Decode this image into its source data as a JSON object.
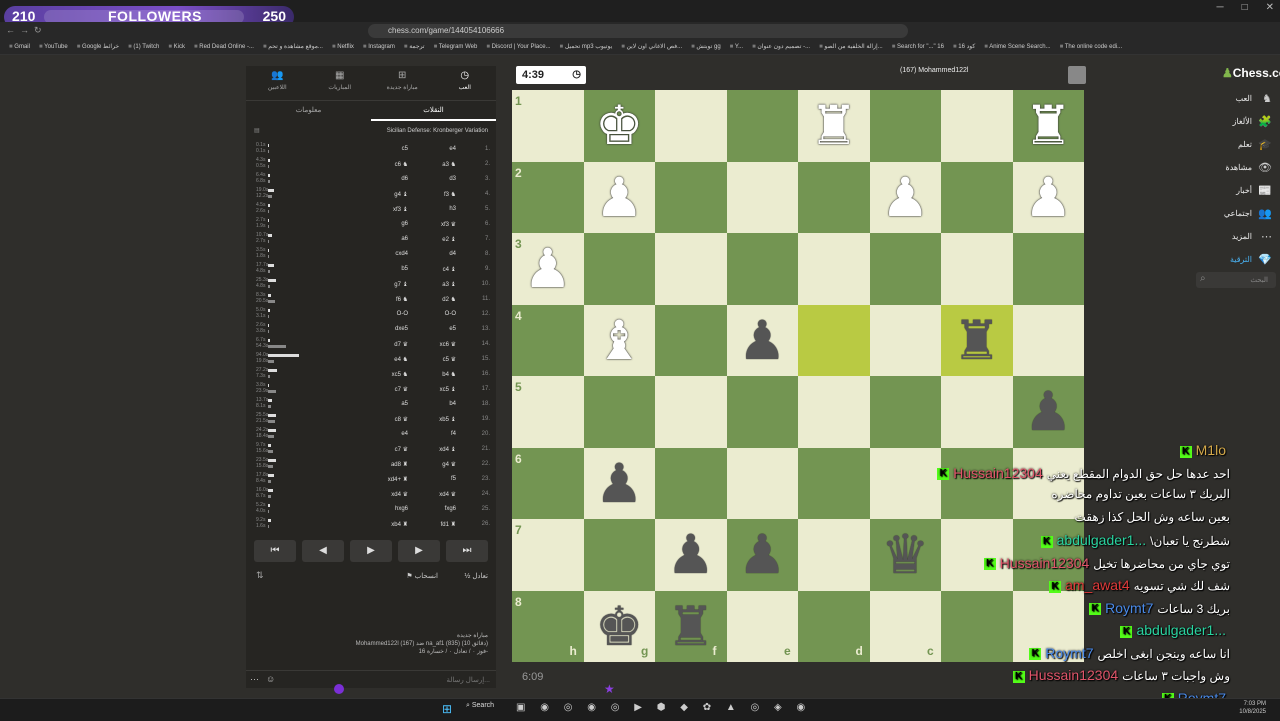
{
  "overlay": {
    "followers_current": "210",
    "followers_label": "FOLLOWERS",
    "followers_goal": "250",
    "progress": 0.84
  },
  "browser": {
    "url": "chess.com/game/144054106666",
    "bookmarks": [
      "Gmail",
      "YouTube",
      "Google خرائط",
      "(1) Twitch",
      "Kick",
      "Red Dead Online -...",
      "موقع مشاهدة و تحم...",
      "Netflix",
      "Instagram",
      "ترجمة",
      "Telegram Web",
      "Discord | Your Place...",
      "تحميل mp3 يوتيوب",
      "فص الاغاني اون لاين...",
      "توبتش gg",
      "Y...",
      "تصميم دون عنوان -...",
      "إزالة الخلفية من الصو...",
      "Search for \"...\" 16",
      "كود 16",
      "Anime Scene Search...",
      "The online code edi..."
    ]
  },
  "panel": {
    "tabs": [
      {
        "label": "العب",
        "icon": "clock-icon"
      },
      {
        "label": "مباراة جديدة",
        "icon": "plus-icon"
      },
      {
        "label": "المباريات",
        "icon": "grid-icon"
      },
      {
        "label": "اللاعبين",
        "icon": "players-icon"
      }
    ],
    "subtabs": [
      "النقلات",
      "معلومات"
    ],
    "opening": "Sicilian Defense: Kronberger Variation",
    "moves": [
      {
        "n": "1.",
        "w": "e4",
        "b": "c5",
        "tw": "0.1s",
        "tb": "0.1s",
        "bw": 0.02,
        "bb": 0.02
      },
      {
        "n": "2.",
        "w": "a3 ♞",
        "b": "c6 ♞",
        "tw": "4.3s",
        "tb": "0.5s",
        "bw": 0.05,
        "bb": 0.02
      },
      {
        "n": "3.",
        "w": "d3",
        "b": "d6",
        "tw": "6.4s",
        "tb": "6.8s",
        "bw": 0.06,
        "bb": 0.06
      },
      {
        "n": "4.",
        "w": "f3 ♞",
        "b": "g4 ♝",
        "tw": "19.0s",
        "tb": "12.2s",
        "bw": 0.16,
        "bb": 0.1
      },
      {
        "n": "5.",
        "w": "h3",
        "b": "xf3 ♝",
        "tw": "4.5s",
        "tb": "2.6s",
        "bw": 0.04,
        "bb": 0.02
      },
      {
        "n": "6.",
        "w": "xf3 ♛",
        "b": "g6",
        "tw": "2.7s",
        "tb": "1.9s",
        "bw": 0.02,
        "bb": 0.02
      },
      {
        "n": "7.",
        "w": "e2 ♝",
        "b": "a6",
        "tw": "10.7s",
        "tb": "2.7s",
        "bw": 0.09,
        "bb": 0.02
      },
      {
        "n": "8.",
        "w": "d4",
        "b": "cxd4",
        "tw": "3.5s",
        "tb": "1.8s",
        "bw": 0.03,
        "bb": 0.02
      },
      {
        "n": "9.",
        "w": "c4 ♝",
        "b": "b5",
        "tw": "17.7s",
        "tb": "4.8s",
        "bw": 0.15,
        "bb": 0.04
      },
      {
        "n": "10.",
        "w": "a3 ♝",
        "b": "g7 ♝",
        "tw": "25.3s",
        "tb": "4.8s",
        "bw": 0.21,
        "bb": 0.04
      },
      {
        "n": "11.",
        "w": "d2 ♞",
        "b": "f6 ♞",
        "tw": "8.3s",
        "tb": "20.5s",
        "bw": 0.07,
        "bb": 0.17
      },
      {
        "n": "12.",
        "w": "O-O",
        "b": "O-O",
        "tw": "5.0s",
        "tb": "3.1s",
        "bw": 0.04,
        "bb": 0.03
      },
      {
        "n": "13.",
        "w": "e5",
        "b": "dxe5",
        "tw": "2.6s",
        "tb": "3.8s",
        "bw": 0.02,
        "bb": 0.03
      },
      {
        "n": "14.",
        "w": "xc6 ♛",
        "b": "d7 ♛",
        "tw": "6.7s",
        "tb": "54.3s",
        "bw": 0.06,
        "bb": 0.45
      },
      {
        "n": "15.",
        "w": "c5 ♛",
        "b": "e4 ♞",
        "tw": "94.0s",
        "tb": "19.8s",
        "bw": 0.78,
        "bb": 0.16
      },
      {
        "n": "16.",
        "w": "b4 ♞",
        "b": "xc5 ♞",
        "tw": "27.2s",
        "tb": "7.3s",
        "bw": 0.23,
        "bb": 0.06
      },
      {
        "n": "17.",
        "w": "xc5 ♝",
        "b": "c7 ♛",
        "tw": "3.8s",
        "tb": "23.9s",
        "bw": 0.03,
        "bb": 0.2
      },
      {
        "n": "18.",
        "w": "b4",
        "b": "a5",
        "tw": "13.7s",
        "tb": "8.1s",
        "bw": 0.11,
        "bb": 0.07
      },
      {
        "n": "19.",
        "w": "xb5 ♝",
        "b": "c8 ♛",
        "tw": "25.5s",
        "tb": "21.5s",
        "bw": 0.21,
        "bb": 0.18
      },
      {
        "n": "20.",
        "w": "f4",
        "b": "e4",
        "tw": "24.2s",
        "tb": "18.4s",
        "bw": 0.2,
        "bb": 0.15
      },
      {
        "n": "21.",
        "w": "xd4 ♝",
        "b": "c7 ♛",
        "tw": "9.7s",
        "tb": "15.6s",
        "bw": 0.08,
        "bb": 0.13
      },
      {
        "n": "22.",
        "w": "g4 ♛",
        "b": "ad8 ♜",
        "tw": "23.5s",
        "tb": "15.8s",
        "bw": 0.2,
        "bb": 0.13
      },
      {
        "n": "23.",
        "w": "f5",
        "b": "xd4+ ♜",
        "tw": "17.8s",
        "tb": "8.4s",
        "bw": 0.15,
        "bb": 0.07
      },
      {
        "n": "24.",
        "w": "xd4 ♛",
        "b": "xd4 ♛",
        "tw": "16.0s",
        "tb": "8.7s",
        "bw": 0.13,
        "bb": 0.07
      },
      {
        "n": "25.",
        "w": "fxg6",
        "b": "hxg6",
        "tw": "5.2s",
        "tb": "4.0s",
        "bw": 0.04,
        "bb": 0.03
      },
      {
        "n": "26.",
        "w": "fd1 ♜",
        "b": "xb4 ♜",
        "tw": "9.2s",
        "tb": "1.6s",
        "bw": 0.08,
        "bb": 0.02
      }
    ],
    "controls": [
      "⏮",
      "◀",
      "▶",
      "▶",
      "⏭"
    ],
    "draw": "½ تعادل",
    "resign": "⚑ انسحاب",
    "game_title": "مباراة جديدة",
    "game_players": "Mohammed122l (167) ضد na_af1 (835) (10 دقائق)",
    "game_stats": "فوز ٠ / تعادل ٠ / خسارة 16-",
    "chat_placeholder": "إرسال رسالة..."
  },
  "top_player": {
    "clock": "4:39",
    "name": "Mohammed122l",
    "rating": "(167)"
  },
  "bottom_player": {
    "clock": "6:09"
  },
  "board": {
    "ranks": [
      "1",
      "2",
      "3",
      "4",
      "5",
      "6",
      "7",
      "8"
    ],
    "files": [
      "h",
      "g",
      "f",
      "e",
      "d",
      "c",
      "b",
      "a"
    ],
    "pieces": [
      {
        "r": 0,
        "c": 1,
        "p": "♚",
        "w": true
      },
      {
        "r": 0,
        "c": 4,
        "p": "♜",
        "w": true
      },
      {
        "r": 0,
        "c": 7,
        "p": "♜",
        "w": true
      },
      {
        "r": 1,
        "c": 1,
        "p": "♟",
        "w": true
      },
      {
        "r": 1,
        "c": 5,
        "p": "♟",
        "w": true
      },
      {
        "r": 1,
        "c": 7,
        "p": "♟",
        "w": true
      },
      {
        "r": 2,
        "c": 0,
        "p": "♟",
        "w": true
      },
      {
        "r": 3,
        "c": 1,
        "p": "♝",
        "w": true
      },
      {
        "r": 3,
        "c": 3,
        "p": "♟",
        "w": false
      },
      {
        "r": 3,
        "c": 6,
        "p": "♜",
        "w": false
      },
      {
        "r": 4,
        "c": 7,
        "p": "♟",
        "w": false
      },
      {
        "r": 5,
        "c": 1,
        "p": "♟",
        "w": false
      },
      {
        "r": 6,
        "c": 2,
        "p": "♟",
        "w": false
      },
      {
        "r": 6,
        "c": 3,
        "p": "♟",
        "w": false
      },
      {
        "r": 6,
        "c": 5,
        "p": "♛",
        "w": false
      },
      {
        "r": 7,
        "c": 1,
        "p": "♚",
        "w": false
      },
      {
        "r": 7,
        "c": 2,
        "p": "♜",
        "w": false
      }
    ],
    "highlights": [
      {
        "r": 3,
        "c": 4
      },
      {
        "r": 3,
        "c": 6
      }
    ]
  },
  "nav": {
    "brand": "Chess.com",
    "items": [
      {
        "t": "العب",
        "i": "♞"
      },
      {
        "t": "الألغاز",
        "i": "🧩"
      },
      {
        "t": "تعلم",
        "i": "🎓"
      },
      {
        "t": "مشاهدة",
        "i": "👁"
      },
      {
        "t": "أخبار",
        "i": "📰"
      },
      {
        "t": "اجتماعي",
        "i": "👥"
      },
      {
        "t": "المزيد",
        "i": "⋯"
      },
      {
        "t": "الترقية",
        "i": "💎"
      }
    ],
    "search": "البحث"
  },
  "stream_chat": [
    {
      "user": "M1lo",
      "text": "",
      "color": "#d4a94a",
      "kick": true
    },
    {
      "user": "Hussain12304",
      "text": "احد عدها حل حق الدوام المقطع يعني",
      "color": "#e0556a",
      "kick": true
    },
    {
      "user": "",
      "text": "البريك ٣ ساعات بعين تداوم محاضره",
      "color": "#fff",
      "kick": false
    },
    {
      "user": "",
      "text": "بعين ساعه وش الحل كذا زهقت",
      "color": "#fff",
      "kick": false
    },
    {
      "user": "abdulgader1...",
      "text": "\\شطرنج يا تعبان",
      "color": "#2ad4a0",
      "kick": true
    },
    {
      "user": "Hussain12304",
      "text": "توي جاي من محاضرها تخيل",
      "color": "#e0556a",
      "kick": true
    },
    {
      "user": "am_awat4",
      "text": "شف لك شي تسويه",
      "color": "#e03a3a",
      "kick": true
    },
    {
      "user": "Roymt7",
      "text": "بريك 3 ساعات",
      "color": "#4a8ae8",
      "kick": true
    },
    {
      "user": "abdulgader1...",
      "text": "",
      "color": "#2ad4a0",
      "kick": true
    },
    {
      "user": "Roymt7",
      "text": "انا ساعه وينجن ابغى اخلص",
      "color": "#4a8ae8",
      "kick": true
    },
    {
      "user": "Hussain12304",
      "text": "وش واجبات ٣ ساعات",
      "color": "#e0556a",
      "kick": true
    },
    {
      "user": "Roymt7",
      "text": "",
      "color": "#4a8ae8",
      "kick": true
    }
  ],
  "taskbar": {
    "search": "Search",
    "time": "7:03 PM",
    "date": "10/8/2025"
  },
  "colors": {
    "light": "#ebecd0",
    "dark": "#739552",
    "highlight": "#b9ca43",
    "accent": "#81b64c"
  }
}
